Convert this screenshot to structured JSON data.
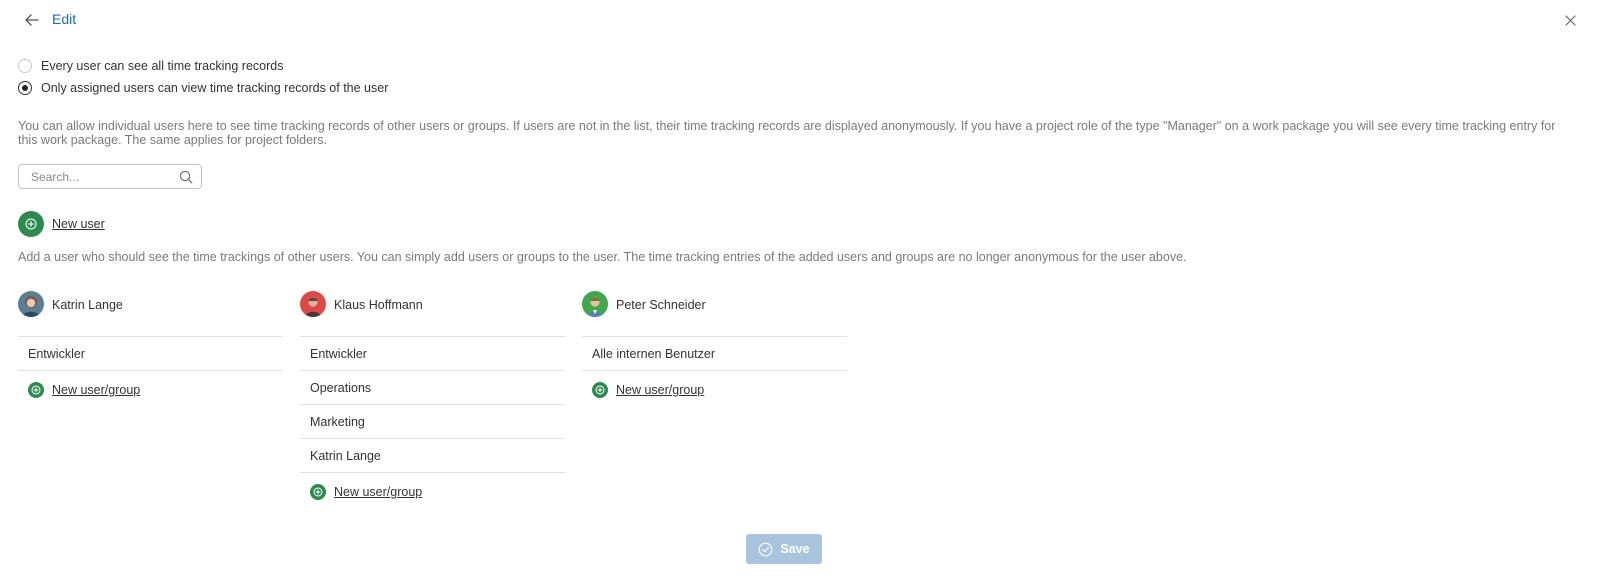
{
  "header": {
    "title": "Edit"
  },
  "visibility": {
    "options": [
      {
        "label": "Every user can see all time tracking records",
        "checked": false
      },
      {
        "label": "Only assigned users can view time tracking records of the user",
        "checked": true
      }
    ],
    "description": "You can allow individual users here to see time tracking records of other users or groups. If users are not in the list, their time tracking records are displayed anonymously. If you have a project role of the type \"Manager\" on a work package you will see every time tracking entry for this work package. The same applies for project folders."
  },
  "search": {
    "placeholder": "Search..."
  },
  "new_user": {
    "label": "New user",
    "description": "Add a user who should see the time trackings of other users. You can simply add users or groups to the user. The time tracking entries of the added users and groups are no longer anonymous for the user above."
  },
  "users": [
    {
      "name": "Katrin Lange",
      "avatar_color": "#5a7f94",
      "members": [
        "Entwickler"
      ],
      "add_label": "New user/group"
    },
    {
      "name": "Klaus Hoffmann",
      "avatar_color": "#e04848",
      "members": [
        "Entwickler",
        "Operations",
        "Marketing",
        "Katrin Lange"
      ],
      "add_label": "New user/group"
    },
    {
      "name": "Peter Schneider",
      "avatar_color": "#3fa84a",
      "members": [
        "Alle internen Benutzer"
      ],
      "add_label": "New user/group"
    }
  ],
  "save": {
    "label": "Save"
  },
  "colors": {
    "accent_green": "#2b8a4e",
    "link_blue": "#1a6bb5",
    "save_disabled": "#a9c4dd"
  }
}
